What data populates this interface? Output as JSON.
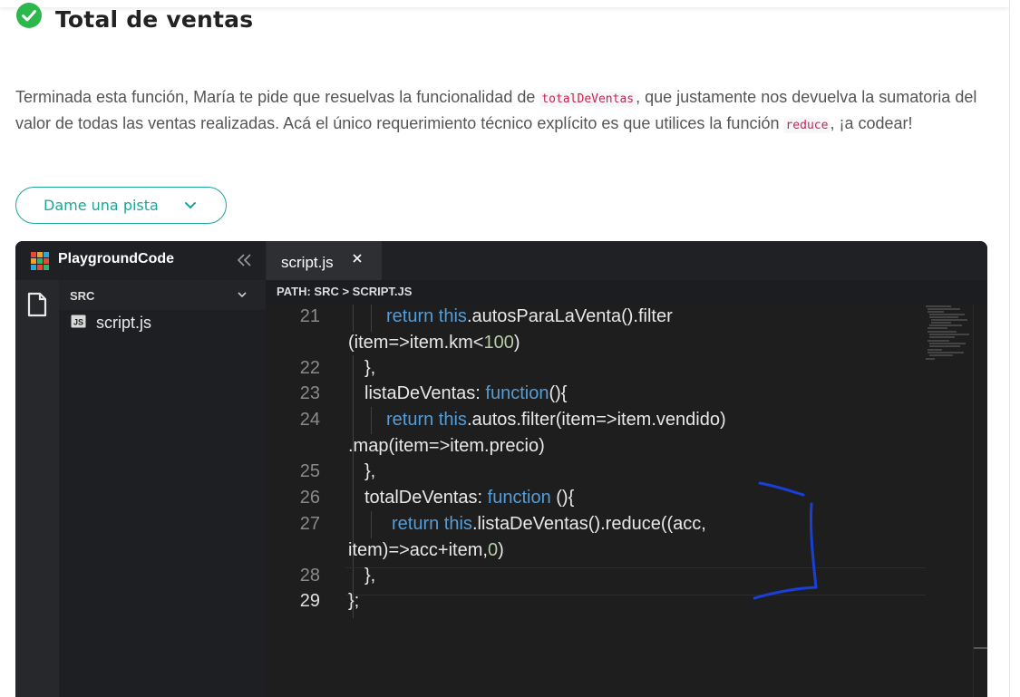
{
  "page": {
    "title": "Total de ventas",
    "description_parts": [
      "Terminada esta función, María te pide que resuelvas la funcionalidad de ",
      "totalDeVentas",
      ", que justamente nos devuelva la sumatoria del valor de todas las ventas realizadas. Acá el único requerimiento técnico explícito es que utilices la función ",
      "reduce",
      ", ¡a codear!"
    ],
    "hint_button_label": "Dame una pista"
  },
  "colors": {
    "accent": "#1aa79a",
    "check_green": "#2cb84a",
    "code_keyword": "#569cd6",
    "code_number": "#b5cea8",
    "annotation_ink": "#1a3fd6"
  },
  "ide": {
    "brand": "PlaygroundCode",
    "active_tab": "script.js",
    "explorer_folder": "SRC",
    "files": [
      "script.js"
    ],
    "path": "PATH: SRC > SCRIPT.JS",
    "lines": [
      {
        "no": "21",
        "t1": "return this",
        "t2": ".autosParaLaVenta().filter",
        "cont": "(item=>item.km<",
        "contNum": "100",
        "contEnd": ")"
      },
      {
        "no": "22",
        "text": "},"
      },
      {
        "no": "23",
        "t0": "listaDeVentas: ",
        "kw": "function",
        "t3": "(){"
      },
      {
        "no": "24",
        "t1": "return this",
        "t2": ".autos.filter(item=>item.vendido)",
        "cont": ".map(item=>item.precio)"
      },
      {
        "no": "25",
        "text": "},"
      },
      {
        "no": "26",
        "t0": "totalDeVentas: ",
        "kw": "function",
        "t3": " (){"
      },
      {
        "no": "27",
        "t1": "return this",
        "t2": ".listaDeVentas().reduce((acc,",
        "cont": "item)=>acc+item,",
        "contNum": "0",
        "contEnd": ")"
      },
      {
        "no": "28",
        "text": "},"
      },
      {
        "no": "29",
        "text": "};"
      }
    ]
  },
  "icons": {
    "check": "check-circle-icon",
    "chevron": "chevron-down-icon",
    "collapse": "double-chevron-left-icon",
    "close": "close-icon",
    "file": "file-icon",
    "js": "js-file-icon",
    "logo": "grid-logo-icon"
  }
}
